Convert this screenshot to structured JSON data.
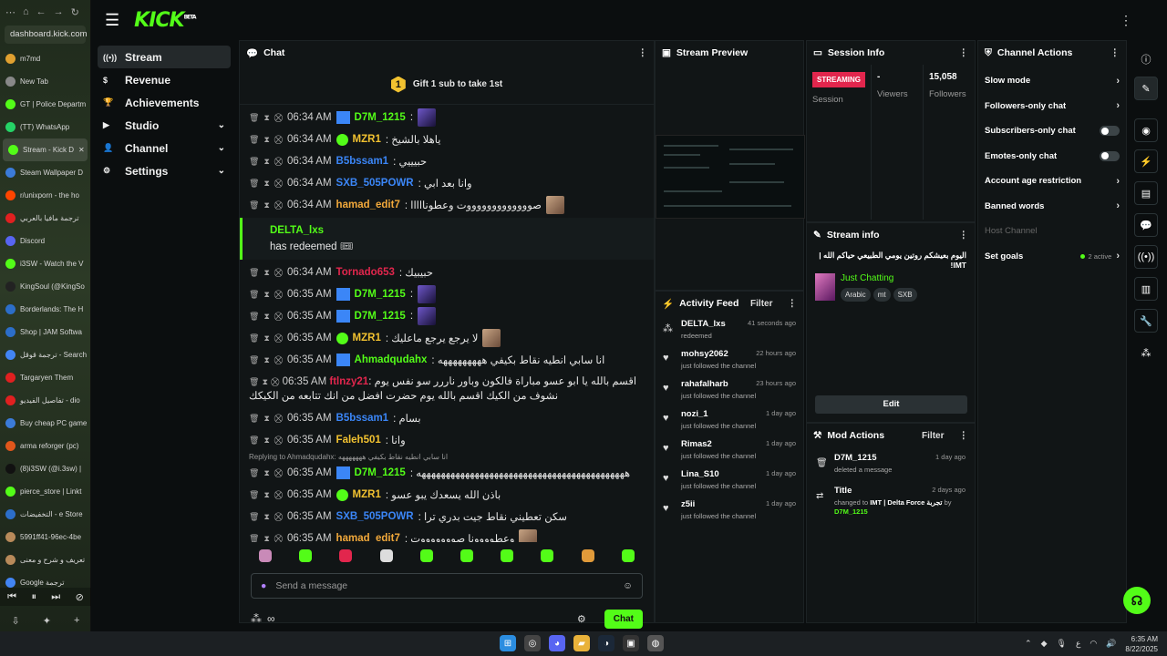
{
  "browser": {
    "address": "dashboard.kick.com",
    "tabs": [
      {
        "label": "m7md",
        "color": "#e0a030",
        "active": false
      },
      {
        "label": "New Tab",
        "color": "#888888",
        "active": false
      },
      {
        "label": "GT | Police Departm",
        "color": "#53fc18",
        "active": false
      },
      {
        "label": "(TT) WhatsApp",
        "color": "#25d366",
        "active": false
      },
      {
        "label": "Stream - Kick D",
        "color": "#53fc18",
        "active": true
      },
      {
        "label": "Steam Wallpaper D",
        "color": "#3b7bd9",
        "active": false
      },
      {
        "label": "r/unixporn - the ho",
        "color": "#ff4500",
        "active": false
      },
      {
        "label": "ترجمة مافيا بالعربي",
        "color": "#e02020",
        "active": false
      },
      {
        "label": "Discord",
        "color": "#5865f2",
        "active": false
      },
      {
        "label": "i3SW - Watch the V",
        "color": "#53fc18",
        "active": false
      },
      {
        "label": "KingSoul (@KingSo",
        "color": "#222222",
        "active": false
      },
      {
        "label": "Borderlands: The H",
        "color": "#2c6ec9",
        "active": false
      },
      {
        "label": "Shop | JAM Softwa",
        "color": "#2c6ec9",
        "active": false
      },
      {
        "label": "ترجمة قوقل - Search",
        "color": "#4285f4",
        "active": false
      },
      {
        "label": "Targaryen Them",
        "color": "#e02020",
        "active": false
      },
      {
        "label": "تفاصيل الفيديو - dio",
        "color": "#e02020",
        "active": false
      },
      {
        "label": "Buy cheap PC game",
        "color": "#3b7bd9",
        "active": false
      },
      {
        "label": "arma reforger (pc)",
        "color": "#e0561b",
        "active": false
      },
      {
        "label": "(8)i3SW (@i.3sw) |",
        "color": "#111111",
        "active": false
      },
      {
        "label": "pierce_store | Linkt",
        "color": "#53fc18",
        "active": false
      },
      {
        "label": "التخفيضات - e Store",
        "color": "#2c6ec9",
        "active": false
      },
      {
        "label": "5991ff41-96ec-4be",
        "color": "#b88a5a",
        "active": false
      },
      {
        "label": "تعريف و شرح و معنى",
        "color": "#b88a5a",
        "active": false
      },
      {
        "label": "Google ترجمة",
        "color": "#4285f4",
        "active": false
      }
    ]
  },
  "nav": {
    "items": [
      {
        "label": "Stream",
        "icon": "broadcast-icon",
        "active": true,
        "chevron": false
      },
      {
        "label": "Revenue",
        "icon": "dollar-icon",
        "active": false,
        "chevron": false
      },
      {
        "label": "Achievements",
        "icon": "trophy-icon",
        "active": false,
        "chevron": false
      },
      {
        "label": "Studio",
        "icon": "studio-icon",
        "active": false,
        "chevron": true
      },
      {
        "label": "Channel",
        "icon": "user-icon",
        "active": false,
        "chevron": true
      },
      {
        "label": "Settings",
        "icon": "gear-icon",
        "active": false,
        "chevron": true
      }
    ]
  },
  "chat": {
    "title": "Chat",
    "gift_text": "Gift 1 sub to take 1st",
    "gift_rank": "1",
    "messages": [
      {
        "time": "06:34 AM",
        "user": "D7M_1215",
        "color": "#53fc18",
        "text": ":",
        "badges": "blue",
        "emote": "dark"
      },
      {
        "time": "06:34 AM",
        "user": "MZR1",
        "color": "#f2c230",
        "text": ": ياهلا بالشيخ",
        "badges": "verified",
        "emote": ""
      },
      {
        "time": "06:34 AM",
        "user": "B5bssam1",
        "color": "#3b86f7",
        "text": ": حبيييي",
        "badges": "",
        "emote": ""
      },
      {
        "time": "06:34 AM",
        "user": "SXB_505POWR",
        "color": "#3b86f7",
        "text": ": وانا بعد ابي",
        "badges": "",
        "emote": ""
      },
      {
        "time": "06:34 AM",
        "user": "hamad_edit7",
        "color": "#f2a93b",
        "text": ": صوووووووووووووت وعطونااااا",
        "badges": "",
        "emote": "face"
      }
    ],
    "redeem": {
      "user": "DELTA_lxs",
      "text": "has redeemed 🎟"
    },
    "messages2": [
      {
        "time": "06:34 AM",
        "user": "Tornado653",
        "color": "#e2264d",
        "text": ": حبيبيك",
        "badges": "",
        "emote": ""
      },
      {
        "time": "06:35 AM",
        "user": "D7M_1215",
        "color": "#53fc18",
        "text": ":",
        "badges": "blue",
        "emote": "dark"
      },
      {
        "time": "06:35 AM",
        "user": "D7M_1215",
        "color": "#53fc18",
        "text": ":",
        "badges": "blue",
        "emote": "dark"
      },
      {
        "time": "06:35 AM",
        "user": "MZR1",
        "color": "#f2c230",
        "text": ": لا يرجع يرجع ماعليك",
        "badges": "verified",
        "emote": "face"
      },
      {
        "time": "06:35 AM",
        "user": "Ahmadqudahx",
        "color": "#53fc18",
        "text": ": انا سابي انطيه نقاط بكيفي هههههههههه",
        "badges": "blue",
        "emote": ""
      }
    ],
    "long_msg": {
      "time": "06:35 AM",
      "user": "ftlnzy21",
      "color": "#e2264d",
      "text": ": اقسم بالله يا ابو عسو مباراة فالكون وباور ناررر سو نفس يوم نشوف من الكيك اقسم بالله يوم حضرت افضل من انك تتابعه من الكيكك"
    },
    "messages3": [
      {
        "time": "06:35 AM",
        "user": "B5bssam1",
        "color": "#3b86f7",
        "text": ": بسام",
        "badges": "",
        "emote": ""
      },
      {
        "time": "06:35 AM",
        "user": "Faleh501",
        "color": "#f2c230",
        "text": ": وانا",
        "badges": "",
        "emote": ""
      }
    ],
    "reply_to": "Replying to Ahmadqudahx: انا سابي انطيه نقاط بكيفي هههههههه",
    "messages4": [
      {
        "time": "06:35 AM",
        "user": "D7M_1215",
        "color": "#53fc18",
        "text": ": هههههههههههههههههههههههههههههههههههههههههههه",
        "badges": "blue",
        "emote": ""
      },
      {
        "time": "06:35 AM",
        "user": "MZR1",
        "color": "#f2c230",
        "text": ": باذن الله يسعدك يبو عسو",
        "badges": "verified",
        "emote": ""
      },
      {
        "time": "06:35 AM",
        "user": "SXB_505POWR",
        "color": "#3b86f7",
        "text": ": سكن تعطيني نقاط جيت بدري ترا",
        "badges": "",
        "emote": ""
      },
      {
        "time": "06:35 AM",
        "user": "hamad_edit7",
        "color": "#f2a93b",
        "text": ": وعطوووونا صوووووووت",
        "badges": "",
        "emote": "face"
      }
    ],
    "input_placeholder": "Send a message",
    "send_label": "Chat"
  },
  "preview": {
    "title": "Stream Preview"
  },
  "session": {
    "title": "Session Info",
    "live_label": "STREAMING",
    "session_label": "Session",
    "viewers_value": "-",
    "viewers_label": "Viewers",
    "followers_value": "15,058",
    "followers_label": "Followers"
  },
  "stream_info": {
    "title": "Stream info",
    "stream_title": "اليوم بعيشكم روتين يومي الطبيعي حياكم الله | IMT!",
    "category": "Just Chatting",
    "tags": [
      "Arabic",
      "mt",
      "SXB"
    ],
    "edit_label": "Edit"
  },
  "activity": {
    "title": "Activity Feed",
    "filter_label": "Filter",
    "items": [
      {
        "name": "DELTA_lxs",
        "when": "41 seconds ago",
        "sub": "redeemed",
        "icon": "redeem-icon"
      },
      {
        "name": "mohsy2062",
        "when": "22 hours ago",
        "sub": "just followed the channel",
        "icon": "heart-icon"
      },
      {
        "name": "rahafalharb",
        "when": "23 hours ago",
        "sub": "just followed the channel",
        "icon": "heart-icon"
      },
      {
        "name": "nozi_1",
        "when": "1 day ago",
        "sub": "just followed the channel",
        "icon": "heart-icon"
      },
      {
        "name": "Rimas2",
        "when": "1 day ago",
        "sub": "just followed the channel",
        "icon": "heart-icon"
      },
      {
        "name": "Lina_S10",
        "when": "1 day ago",
        "sub": "just followed the channel",
        "icon": "heart-icon"
      },
      {
        "name": "z5ii",
        "when": "1 day ago",
        "sub": "just followed the channel",
        "icon": "heart-icon"
      }
    ]
  },
  "mod_actions": {
    "title": "Mod Actions",
    "filter_label": "Filter",
    "items": [
      {
        "name": "D7M_1215",
        "when": "1 day ago",
        "sub": "deleted a message"
      },
      {
        "name": "Title",
        "when": "2 days ago",
        "sub_prefix": "changed to",
        "sub_bold": "IMT | Delta Force تجربة",
        "sub_by": "by",
        "sub_user": "D7M_1215"
      }
    ]
  },
  "channel_actions": {
    "title": "Channel Actions",
    "items": [
      {
        "label": "Slow mode",
        "kind": "chevron"
      },
      {
        "label": "Followers-only chat",
        "kind": "chevron"
      },
      {
        "label": "Subscribers-only chat",
        "kind": "toggle"
      },
      {
        "label": "Emotes-only chat",
        "kind": "toggle"
      },
      {
        "label": "Account age restriction",
        "kind": "chevron"
      },
      {
        "label": "Banned words",
        "kind": "chevron"
      },
      {
        "label": "Host Channel",
        "kind": "dim"
      },
      {
        "label": "Set goals",
        "kind": "goals",
        "extra": "2 active"
      }
    ]
  },
  "taskbar": {
    "time": "6:35 AM",
    "date": "8/22/2025",
    "lang": "ع"
  },
  "colors": {
    "brand": "#53fc18",
    "live": "#e2264d"
  }
}
